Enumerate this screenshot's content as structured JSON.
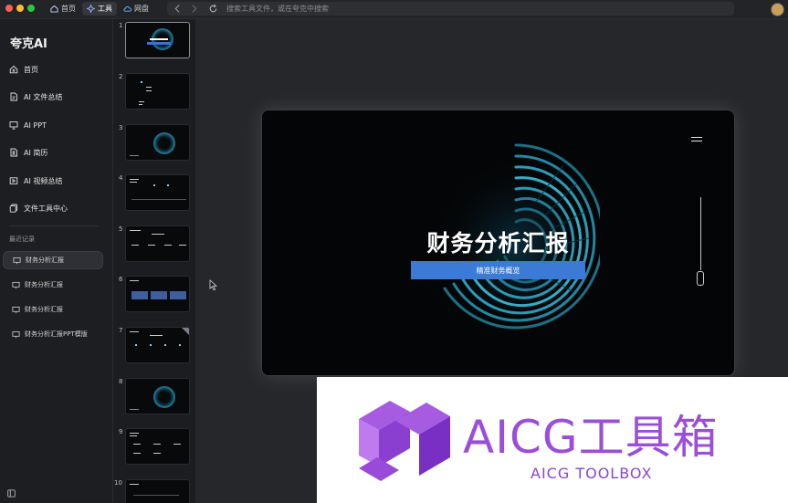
{
  "topbar": {
    "tabs": [
      {
        "label": "首页",
        "icon": "home-icon"
      },
      {
        "label": "工具",
        "icon": "sparkle-icon",
        "active": true
      },
      {
        "label": "网盘",
        "icon": "cloud-icon"
      }
    ],
    "search_placeholder": "搜索工具文件，或在夸克中搜索"
  },
  "sidebar": {
    "brand": "夸克AI",
    "nav": [
      {
        "label": "首页",
        "icon": "home-icon"
      },
      {
        "label": "AI 文件总结",
        "icon": "file-summary-icon"
      },
      {
        "label": "AI PPT",
        "icon": "ppt-icon"
      },
      {
        "label": "AI 简历",
        "icon": "resume-icon"
      },
      {
        "label": "AI 视频总结",
        "icon": "video-summary-icon"
      },
      {
        "label": "文件工具中心",
        "icon": "file-tools-icon"
      }
    ],
    "recent_title": "最近记录",
    "recent": [
      {
        "label": "财务分析汇报",
        "active": true
      },
      {
        "label": "财务分析汇报"
      },
      {
        "label": "财务分析汇报"
      },
      {
        "label": "财务分析汇报PPT模版"
      }
    ]
  },
  "thumbnails": [
    {
      "num": "1"
    },
    {
      "num": "2"
    },
    {
      "num": "3"
    },
    {
      "num": "4"
    },
    {
      "num": "5"
    },
    {
      "num": "6"
    },
    {
      "num": "7"
    },
    {
      "num": "8"
    },
    {
      "num": "9"
    },
    {
      "num": "10"
    }
  ],
  "slide": {
    "title": "财务分析汇报",
    "subtitle": "精准财务概览"
  },
  "watermark": {
    "title": "AICG工具箱",
    "subtitle": "AICG TOOLBOX",
    "color": "#9b4fd8"
  }
}
